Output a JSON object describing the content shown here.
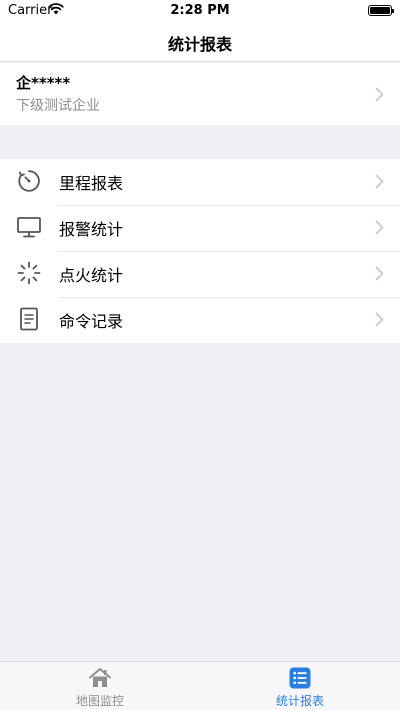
{
  "status_bar": {
    "carrier": "Carrier",
    "time": "2:28 PM"
  },
  "nav": {
    "title": "统计报表"
  },
  "company": {
    "name": "企*****",
    "subtitle": "下级测试企业"
  },
  "menu": [
    {
      "label": "里程报表",
      "icon": "speedometer-icon"
    },
    {
      "label": "报警统计",
      "icon": "monitor-icon"
    },
    {
      "label": "点火统计",
      "icon": "spark-icon"
    },
    {
      "label": "命令记录",
      "icon": "document-icon"
    }
  ],
  "tabs": [
    {
      "label": "地图监控",
      "icon": "home-icon",
      "active": false
    },
    {
      "label": "统计报表",
      "icon": "list-icon",
      "active": true
    }
  ],
  "colors": {
    "accent": "#2a7de1",
    "inactive": "#8e8e93",
    "icon": "#555555",
    "background": "#efeff4"
  }
}
